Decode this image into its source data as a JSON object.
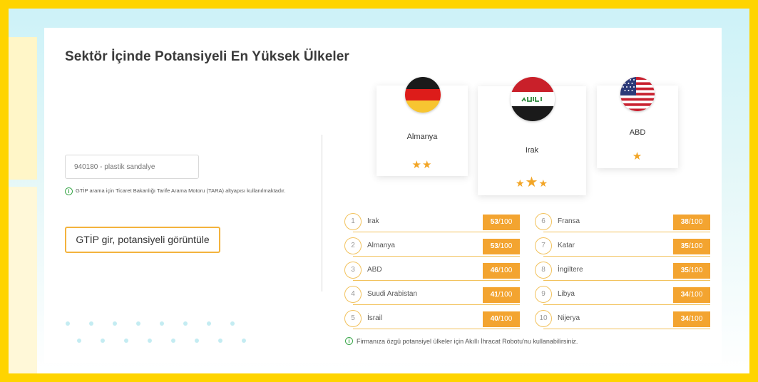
{
  "title": "Sektör İçinde Potansiyeli En Yüksek Ülkeler",
  "search": {
    "placeholder": "940180 - plastik sandalye"
  },
  "info_text": "GTİP arama için Ticaret Bakanlığı Tarife Arama Motoru (TARA) altyapısı kullanılmaktadır.",
  "info_icon": "info-icon",
  "button_label": "GTİP gir, potansiyeli görüntüle",
  "podium": [
    {
      "name": "Almanya",
      "stars": "★★",
      "flag": "germany"
    },
    {
      "name": "Irak",
      "stars": "★★★",
      "flag": "iraq"
    },
    {
      "name": "ABD",
      "stars": "★",
      "flag": "usa"
    }
  ],
  "ranking": [
    {
      "rank": "1",
      "name": "Irak",
      "score": "53",
      "max": "/100"
    },
    {
      "rank": "2",
      "name": "Almanya",
      "score": "53",
      "max": "/100"
    },
    {
      "rank": "3",
      "name": "ABD",
      "score": "46",
      "max": "/100"
    },
    {
      "rank": "4",
      "name": "Suudi Arabistan",
      "score": "41",
      "max": "/100"
    },
    {
      "rank": "5",
      "name": "İsrail",
      "score": "40",
      "max": "/100"
    },
    {
      "rank": "6",
      "name": "Fransa",
      "score": "38",
      "max": "/100"
    },
    {
      "rank": "7",
      "name": "Katar",
      "score": "35",
      "max": "/100"
    },
    {
      "rank": "8",
      "name": "İngiltere",
      "score": "35",
      "max": "/100"
    },
    {
      "rank": "9",
      "name": "Libya",
      "score": "34",
      "max": "/100"
    },
    {
      "rank": "10",
      "name": "Nijerya",
      "score": "34",
      "max": "/100"
    }
  ],
  "footer_note": "Firmanıza özgü potansiyel ülkeler için Akıllı İhracat Robotu'nu kullanabilirsiniz.",
  "colors": {
    "accent": "#f3a430",
    "frame": "#ffd400",
    "info": "#3aa64a"
  }
}
